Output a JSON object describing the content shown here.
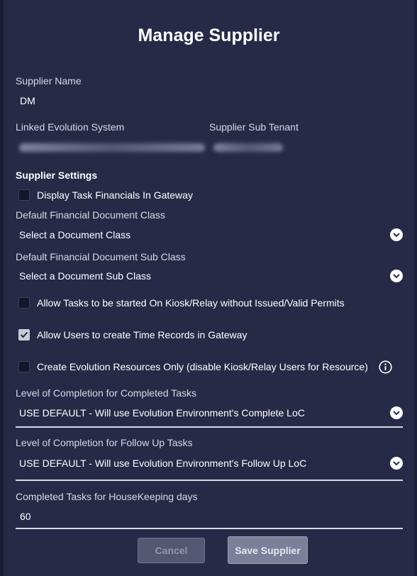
{
  "dialog": {
    "title": "Manage Supplier",
    "supplier_name_label": "Supplier Name",
    "supplier_name_value": "DM",
    "linked_system_label": "Linked Evolution System",
    "sub_tenant_label": "Supplier Sub Tenant",
    "settings_heading": "Supplier Settings",
    "display_financials": {
      "label": "Display Task Financials In Gateway",
      "checked": false
    },
    "doc_class_label": "Default Financial Document Class",
    "doc_class_value": "Select a Document Class",
    "doc_subclass_label": "Default Financial Document Sub Class",
    "doc_subclass_value": "Select a Document Sub Class",
    "allow_kiosk": {
      "label": "Allow Tasks to be started On Kiosk/Relay without Issued/Valid Permits",
      "checked": false
    },
    "allow_time_records": {
      "label": "Allow Users to create Time Records in Gateway",
      "checked": true
    },
    "create_resources": {
      "label": "Create Evolution Resources Only (disable Kiosk/Relay Users for Resource)",
      "checked": false
    },
    "loc_completed_label": "Level of Completion for Completed Tasks",
    "loc_completed_value": "USE DEFAULT - Will use Evolution Environment's Complete LoC",
    "loc_followup_label": "Level of Completion for Follow Up Tasks",
    "loc_followup_value": "USE DEFAULT - Will use Evolution Environment's Follow Up LoC",
    "housekeeping_label": "Completed Tasks for HouseKeeping days",
    "housekeeping_value": "60",
    "cancel_label": "Cancel",
    "save_label": "Save Supplier"
  },
  "icons": {
    "dropdown": "chevron-down-icon",
    "info": "info-icon",
    "check": "checkmark-icon"
  },
  "colors": {
    "background": "#262a47",
    "text": "#ffffff",
    "muted_label": "#d7d9e6",
    "checkbox_bg": "#14172a"
  }
}
